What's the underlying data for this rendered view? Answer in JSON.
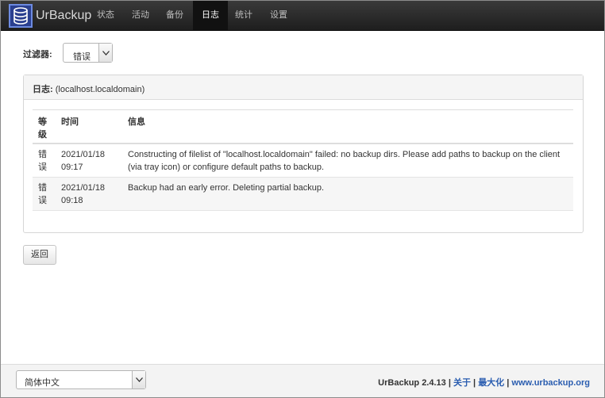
{
  "nav": {
    "brand": "UrBackup",
    "items": [
      {
        "label": "状态"
      },
      {
        "label": "活动"
      },
      {
        "label": "备份"
      },
      {
        "label": "日志"
      },
      {
        "label": "统计"
      },
      {
        "label": "设置"
      }
    ],
    "active_index": 3
  },
  "filter": {
    "label": "过滤器:",
    "selected": "错误"
  },
  "panel": {
    "title_bold": "日志:",
    "title_rest": " (localhost.localdomain)"
  },
  "table": {
    "headers": {
      "level": "等级",
      "time": "时间",
      "message": "信息"
    },
    "rows": [
      {
        "level": "错误",
        "date": "2021/01/18",
        "clock": "09:17",
        "message": "Constructing of filelist of \"localhost.localdomain\" failed: no backup dirs. Please add paths to backup on the client (via tray icon) or configure default paths to backup."
      },
      {
        "level": "错误",
        "date": "2021/01/18",
        "clock": "09:18",
        "message": "Backup had an early error. Deleting partial backup."
      }
    ]
  },
  "back_button": "返回",
  "footer": {
    "language": "简体中文",
    "version": "UrBackup 2.4.13",
    "about": "关于",
    "maximize": "最大化",
    "website": "www.urbackup.org"
  },
  "colors": {
    "navbar": "#2b2b2b",
    "active_tab": "#111111",
    "link": "#2a5db0",
    "logo": "#2a3f8f"
  }
}
